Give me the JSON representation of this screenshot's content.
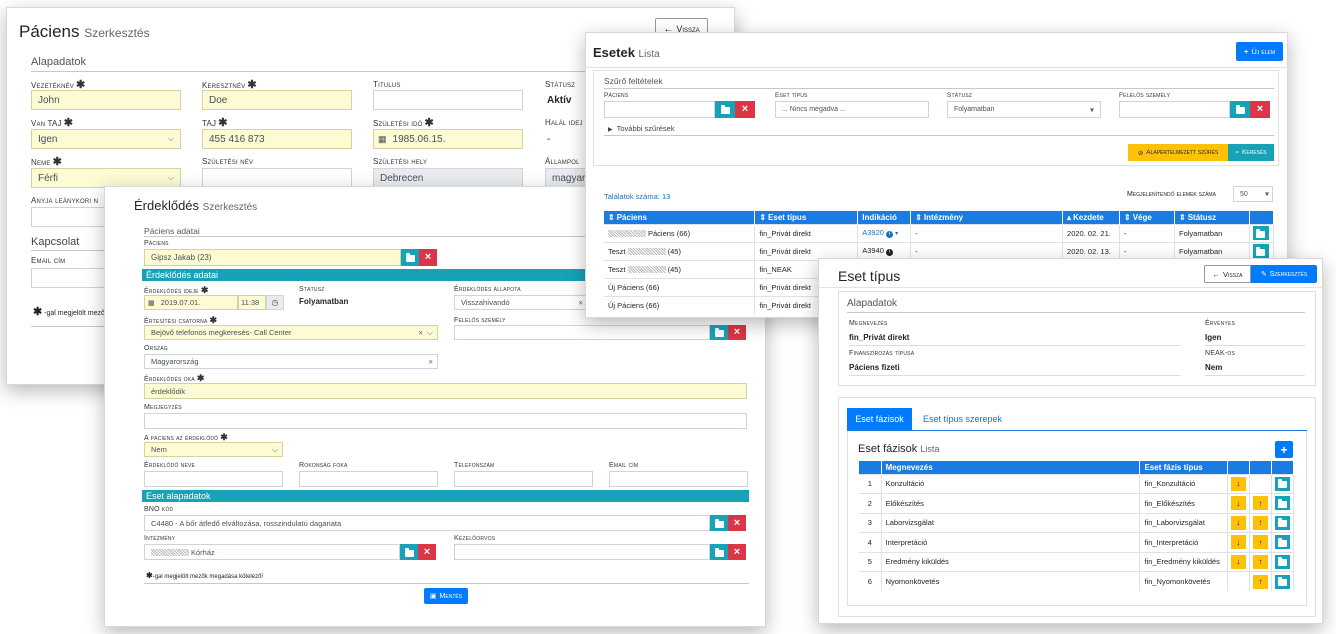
{
  "paciens": {
    "title": "Páciens",
    "subtitle": "Szerkesztés",
    "back": "Vissza",
    "section": "Alapadatok",
    "lbl_vezeteknev": "Vezetéknév",
    "val_vezeteknev": "John",
    "lbl_keresztnev": "Keresztnév",
    "val_keresztnev": "Doe",
    "lbl_titulus": "Titulus",
    "lbl_statusz": "Státusz",
    "val_statusz": "Aktív",
    "lbl_vantaj": "Van TAJ",
    "val_vantaj": "Igen",
    "lbl_taj": "TAJ",
    "val_taj": "455 416 873",
    "lbl_szulido": "Születési idő",
    "val_szulido": "1985.06.15.",
    "lbl_halal": "Halál idej",
    "val_halal": "-",
    "lbl_neme": "Neme",
    "val_neme": "Férfi",
    "lbl_szulnev": "Születési név",
    "lbl_szulhely": "Születési hely",
    "val_szulhely": "Debrecen",
    "lbl_allampol": "Állampol",
    "val_allampol": "magyar",
    "lbl_anyja": "Anyja leánykori n",
    "section_kapcsolat": "Kapcsolat",
    "lbl_email": "Email cím",
    "footnote": "-gal megjelölt mező"
  },
  "erdeklodes": {
    "title": "Érdeklődés",
    "subtitle": "Szerkesztés",
    "section_paciens": "Páciens adatai",
    "lbl_paciens": "Páciens",
    "val_paciens": "Gipsz Jakab (23)",
    "bar_erdeklodes": "Érdeklődés adatai",
    "lbl_ideje": "Érdeklődés ideje",
    "val_date": "2019.07.01.",
    "val_time": "11:38",
    "lbl_statusz": "Státusz",
    "val_statusz": "Folyamatban",
    "lbl_allapota": "Érdeklődés állapota",
    "val_allapota": "Visszahívandó",
    "lbl_csatorna": "Értesítési csatorna",
    "val_csatorna": "Bejövő telefonos megkeresés- Call Center",
    "lbl_felelos": "Felelős személy",
    "lbl_orszag": "Ország",
    "val_orszag": "Magyarország",
    "lbl_oka": "Érdeklődés oka",
    "val_oka": "érdeklődik",
    "lbl_megjegyzes": "Megjegyzés",
    "lbl_azerdeklodo": "A páciens az érdeklődő",
    "val_azerdeklodo": "Nem",
    "lbl_neve": "Érdeklődő neve",
    "lbl_rokonsag": "Rokonság foka",
    "lbl_telefon": "Telefonszám",
    "lbl_email": "Email cím",
    "bar_eset": "Eset alapadatok",
    "lbl_bno": "BNO kód",
    "val_bno": "C4480 - A bőr átfedő elváltozása, rosszindulatú daganata",
    "lbl_intezmeny": "Intézmény",
    "val_intezmeny": "Kórház",
    "lbl_kezelo": "Kezelőorvos",
    "footnote": "-gal megjelölt mezők megadása kötelező!",
    "save": "Mentés"
  },
  "esetek": {
    "title": "Esetek",
    "subtitle": "Lista",
    "new_btn": "Új elem",
    "filter_title": "Szűrő feltételek",
    "lbl_paciens": "Páciens",
    "lbl_esettipus": "Eset típus",
    "val_esettipus": "... Nincs megadva ...",
    "lbl_statusz": "Státusz",
    "val_statusz": "Folyamatban",
    "lbl_felelos": "Felelős személy",
    "more": "További szűrések",
    "default_btn": "Alapértelmezett szűrés",
    "search_btn": "Keresés",
    "count": "Találatok száma: 13",
    "per_page_lbl": "Megjelenítendő elemek száma",
    "per_page": "50",
    "headers": [
      "Páciens",
      "Eset típus",
      "Indikáció",
      "Intézmény",
      "Kezdete",
      "Vége",
      "Státusz"
    ],
    "rows": [
      {
        "pat": "Páciens (66)",
        "pre": "",
        "type": "fin_Privát direkt",
        "ind": "A3920",
        "inst": "-",
        "start": "2020. 02. 21.",
        "end": "-",
        "status": "Folyamatban"
      },
      {
        "pat": "(45)",
        "pre": "Teszt",
        "type": "fin_Privát direkt",
        "ind": "A3940",
        "inst": "-",
        "start": "2020. 02. 13.",
        "end": "-",
        "status": "Folyamatban"
      },
      {
        "pat": "(45)",
        "pre": "Teszt",
        "type": "fin_NEAK",
        "ind": "",
        "inst": "",
        "start": "",
        "end": "",
        "status": ""
      },
      {
        "pat": "Új Páciens (66)",
        "pre": "",
        "type": "fin_Privát direkt",
        "ind": "",
        "inst": "",
        "start": "",
        "end": "",
        "status": ""
      },
      {
        "pat": "Új Páciens (66)",
        "pre": "",
        "type": "fin_Privát direkt",
        "ind": "",
        "inst": "",
        "start": "",
        "end": "",
        "status": ""
      }
    ]
  },
  "esettipus": {
    "title": "Eset típus",
    "back": "Vissza",
    "edit": "Szerkesztés",
    "section": "Alapadatok",
    "lbl_megnevezes": "Megnevezés",
    "val_megnevezes": "fin_Privát direkt",
    "lbl_ervenyes": "Érvényes",
    "val_ervenyes": "Igen",
    "lbl_finansz": "Finanszírozás típusa",
    "val_finansz": "Páciens fizeti",
    "lbl_neak": "NEAK-os",
    "val_neak": "Nem",
    "tab1": "Eset fázisok",
    "tab2": "Eset típus szerepek",
    "list_title": "Eset fázisok",
    "list_sub": "Lista",
    "headers": [
      "Megnevezés",
      "Eset fázis típus"
    ],
    "rows": [
      {
        "n": "1",
        "name": "Konzultáció",
        "type": "fin_Konzultáció",
        "down": true,
        "up": false
      },
      {
        "n": "2",
        "name": "Előkészítés",
        "type": "fin_Előkészítés",
        "down": true,
        "up": true
      },
      {
        "n": "3",
        "name": "Laborvizsgálat",
        "type": "fin_Laborvizsgálat",
        "down": true,
        "up": true
      },
      {
        "n": "4",
        "name": "Interpretáció",
        "type": "fin_Interpretáció",
        "down": true,
        "up": true
      },
      {
        "n": "5",
        "name": "Eredmény kiküldés",
        "type": "fin_Eredmény kiküldés",
        "down": true,
        "up": true
      },
      {
        "n": "6",
        "name": "Nyomonkövetés",
        "type": "fin_Nyomonkövetés",
        "down": false,
        "up": true
      }
    ]
  }
}
